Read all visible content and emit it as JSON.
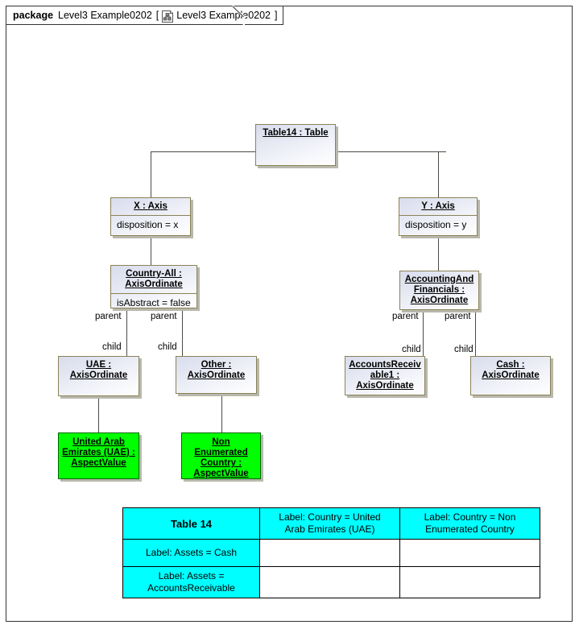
{
  "package": {
    "keyword": "package",
    "name": "Level3 Example0202",
    "bracket_open": "[",
    "bracket_close": "]",
    "diagram_name": "Level3 Example0202",
    "icon": "package-diagram-icon"
  },
  "colors": {
    "node_border": "#8a8257",
    "node_fill_top": "#d9dcec",
    "node_fill_bottom": "#ffffff",
    "aspect_value_fill": "#00ff00",
    "table_header_fill": "#00ffff",
    "line": "#4b4b44",
    "frame_border": "#333333"
  },
  "nodes": {
    "table14": {
      "title": "Table14 : Table",
      "attrs": ""
    },
    "x_axis": {
      "title": "X : Axis",
      "attrs": "disposition = x"
    },
    "y_axis": {
      "title": "Y : Axis",
      "attrs": "disposition = y"
    },
    "country_all": {
      "title": "Country-All :\nAxisOrdinate",
      "attrs": "isAbstract = false"
    },
    "accounting_financials": {
      "title": "AccountingAnd\nFinancials :\nAxisOrdinate",
      "attrs": ""
    },
    "uae": {
      "title": "UAE :\nAxisOrdinate",
      "attrs": ""
    },
    "other": {
      "title": "Other :\nAxisOrdinate",
      "attrs": ""
    },
    "accounts_receivable1": {
      "title": "AccountsReceiv\nable1 :\nAxisOrdinate",
      "attrs": ""
    },
    "cash": {
      "title": "Cash :\nAxisOrdinate",
      "attrs": ""
    },
    "uae_aspect": {
      "title": "United Arab\nEmirates (UAE) :\nAspectValue"
    },
    "non_enum_aspect": {
      "title": "Non\nEnumerated\nCountry :\nAspectValue"
    }
  },
  "edge_labels": {
    "parent_l1": "parent",
    "parent_l2": "parent",
    "child_l1": "child",
    "child_l2": "child",
    "parent_r1": "parent",
    "parent_r2": "parent",
    "child_r1": "child",
    "child_r2": "child"
  },
  "matrix": {
    "corner": "Table 14",
    "col_headers": [
      "Label: Country = United\nArab Emirates (UAE)",
      "Label: Country = Non\nEnumerated Country"
    ],
    "row_headers": [
      "Label: Assets = Cash",
      "Label: Assets =\nAccountsReceivable"
    ],
    "cells": [
      [
        "",
        ""
      ],
      [
        "",
        ""
      ]
    ]
  }
}
